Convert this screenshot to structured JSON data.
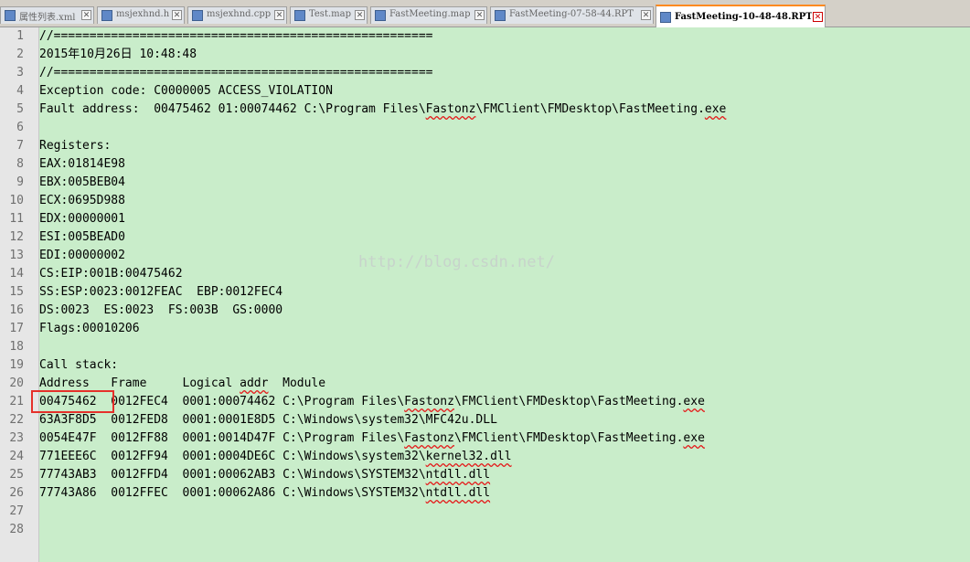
{
  "tabs": [
    {
      "label": "属性列表.xml"
    },
    {
      "label": "msjexhnd.h"
    },
    {
      "label": "msjexhnd.cpp"
    },
    {
      "label": "Test.map"
    },
    {
      "label": "FastMeeting.map"
    },
    {
      "label": "FastMeeting-07-58-44.RPT"
    },
    {
      "label": "FastMeeting-10-48-48.RPT"
    }
  ],
  "close_glyph": "✕",
  "lines": [
    {
      "n": "1",
      "text": "//====================================================="
    },
    {
      "n": "2",
      "text": "2015年10月26日 10:48:48"
    },
    {
      "n": "3",
      "text": "//====================================================="
    },
    {
      "n": "4",
      "text": "Exception code: C0000005 ACCESS_VIOLATION"
    },
    {
      "n": "5",
      "pre": "Fault address:  00475462 01:00074462 C:\\Program Files\\",
      "sq1": "Fastonz",
      "mid": "\\FMClient\\FMDesktop\\FastMeeting.",
      "sq2": "exe"
    },
    {
      "n": "6",
      "text": ""
    },
    {
      "n": "7",
      "text": "Registers:"
    },
    {
      "n": "8",
      "text": "EAX:01814E98"
    },
    {
      "n": "9",
      "text": "EBX:005BEB04"
    },
    {
      "n": "10",
      "text": "ECX:0695D988"
    },
    {
      "n": "11",
      "text": "EDX:00000001"
    },
    {
      "n": "12",
      "text": "ESI:005BEAD0"
    },
    {
      "n": "13",
      "text": "EDI:00000002"
    },
    {
      "n": "14",
      "text": "CS:EIP:001B:00475462"
    },
    {
      "n": "15",
      "text": "SS:ESP:0023:0012FEAC  EBP:0012FEC4"
    },
    {
      "n": "16",
      "text": "DS:0023  ES:0023  FS:003B  GS:0000"
    },
    {
      "n": "17",
      "text": "Flags:00010206"
    },
    {
      "n": "18",
      "text": ""
    },
    {
      "n": "19",
      "text": "Call stack:"
    },
    {
      "n": "20",
      "pre": "Address   Frame     Logical ",
      "sq1": "addr",
      "mid": "  Module",
      "sq2": ""
    },
    {
      "n": "21",
      "pre": "00475462  0012FEC4  0001:00074462 C:\\Program Files\\",
      "sq1": "Fastonz",
      "mid": "\\FMClient\\FMDesktop\\FastMeeting.",
      "sq2": "exe"
    },
    {
      "n": "22",
      "text": "63A3F8D5  0012FED8  0001:0001E8D5 C:\\Windows\\system32\\MFC42u.DLL"
    },
    {
      "n": "23",
      "pre": "0054E47F  0012FF88  0001:0014D47F C:\\Program Files\\",
      "sq1": "Fastonz",
      "mid": "\\FMClient\\FMDesktop\\FastMeeting.",
      "sq2": "exe"
    },
    {
      "n": "24",
      "pre": "771EEE6C  0012FF94  0001:0004DE6C C:\\Windows\\system32\\",
      "sq1": "kernel32.dll",
      "mid": "",
      "sq2": ""
    },
    {
      "n": "25",
      "pre": "77743AB3  0012FFD4  0001:00062AB3 C:\\Windows\\SYSTEM32\\",
      "sq1": "ntdll.dll",
      "mid": "",
      "sq2": ""
    },
    {
      "n": "26",
      "pre": "77743A86  0012FFEC  0001:00062A86 C:\\Windows\\SYSTEM32\\",
      "sq1": "ntdll.dll",
      "mid": "",
      "sq2": ""
    },
    {
      "n": "27",
      "text": ""
    },
    {
      "n": "28",
      "text": ""
    }
  ],
  "watermark": "http://blog.csdn.net/",
  "colors": {
    "editor_bg": "#c9edca",
    "active_tab_accent": "#ff8a1f",
    "highlight_box": "#e5302a"
  }
}
